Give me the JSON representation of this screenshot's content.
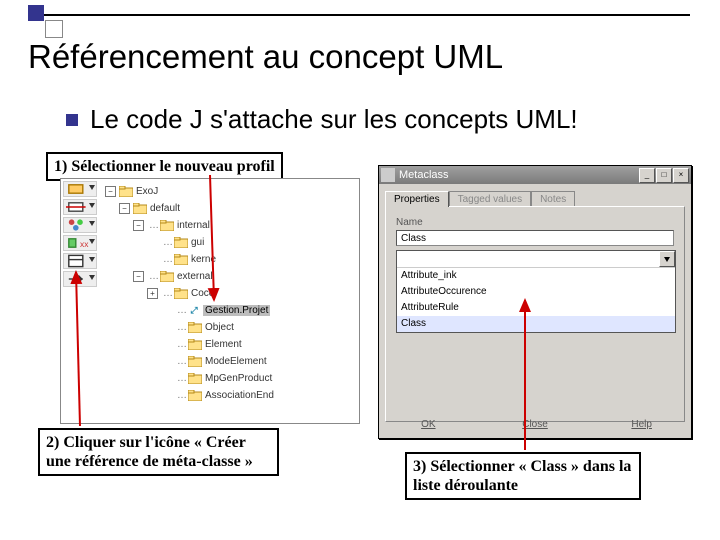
{
  "title": "Référencement au concept UML",
  "bullet": "Le code J s'attache sur les concepts UML!",
  "step1": "1) Sélectionner le nouveau profil",
  "step2": "2) Cliquer sur l'icône « Créer une référence de méta-classe »",
  "step3": "3) Sélectionner « Class » dans la liste déroulante",
  "tree": {
    "root": "ExoJ",
    "n1": "default",
    "n2": "internal",
    "n3": "gui",
    "n4": "kerne",
    "n5": "external",
    "n6": "Coce",
    "n7": "Gestion.Projet",
    "n8": "Object",
    "n9": "Element",
    "n10": "ModeElement",
    "n11": "MpGenProduct",
    "n12": "AssociationEnd"
  },
  "dialog": {
    "title": "Metaclass",
    "tab_props": "Properties",
    "tab_tagged": "Tagged values",
    "tab_notes": "Notes",
    "name_label": "Name",
    "name_value": "Class",
    "options": {
      "o1": "Attribute_ink",
      "o2": "AttributeOccurence",
      "o3": "AttributeRule",
      "o4": "Class"
    },
    "btn_ok": "OK",
    "btn_close": "Close",
    "btn_help": "Help"
  }
}
